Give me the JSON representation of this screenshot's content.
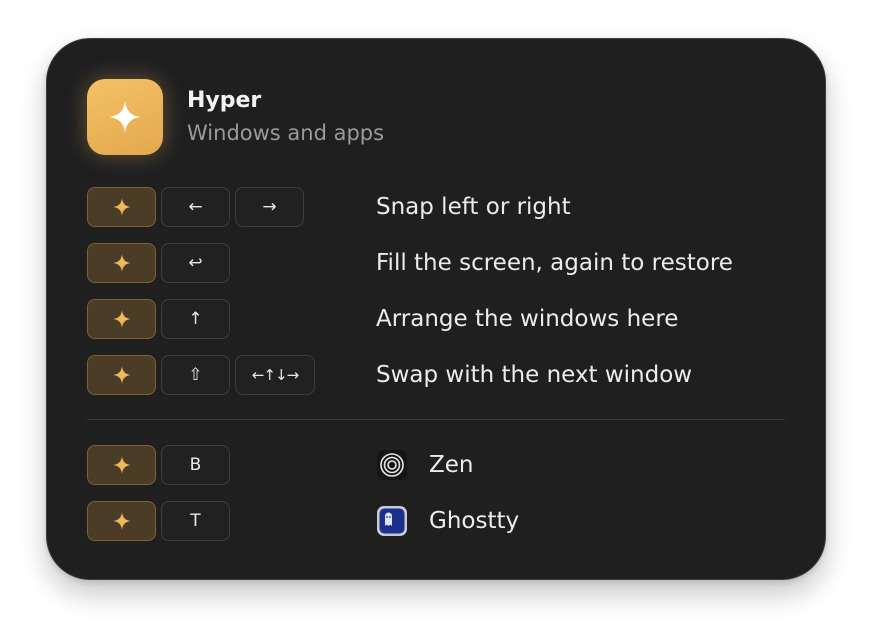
{
  "header": {
    "title": "Hyper",
    "subtitle": "Windows and apps",
    "icon": "sparkle-icon",
    "accent_color": "#f0b85c"
  },
  "window_shortcuts": [
    {
      "keys": [
        "hyper",
        "←",
        "→"
      ],
      "description": "Snap left or right"
    },
    {
      "keys": [
        "hyper",
        "↩"
      ],
      "description": "Fill the screen, again to restore"
    },
    {
      "keys": [
        "hyper",
        "↑"
      ],
      "description": "Arrange the windows here"
    },
    {
      "keys": [
        "hyper",
        "⇧",
        "←↑↓→"
      ],
      "description": "Swap with the next window"
    }
  ],
  "app_shortcuts": [
    {
      "keys": [
        "hyper",
        "B"
      ],
      "app": "Zen",
      "icon": "zen-browser-icon"
    },
    {
      "keys": [
        "hyper",
        "T"
      ],
      "app": "Ghostty",
      "icon": "ghostty-terminal-icon"
    }
  ]
}
